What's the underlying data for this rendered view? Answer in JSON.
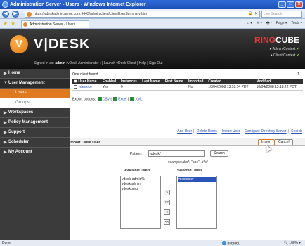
{
  "window": {
    "title": "Administration Server - Users - Windows Internet Explorer",
    "buttons": [
      "_",
      "□",
      "✕"
    ]
  },
  "addressbar": {
    "url": "https://vdeskadmin.acme.com:9443/admin/client/clientUserSummary.htm",
    "search_placeholder": "Live Search",
    "back": "◀",
    "forward": "▶"
  },
  "tabs": {
    "active_tab": "Administration Server - Users",
    "tools": [
      "⌂ ▾",
      "✉ ▾",
      "🖶 ▾",
      "Page ▾",
      "Tools ▾"
    ]
  },
  "banner": {
    "logo_mark": "V",
    "logo_text": "V|DESK",
    "signed_prefix": "Signed in as: ",
    "signed_user": "admin",
    "signed_rest": " (vDesk Administrator ) | Launch vDesk Client | Help | Sign Out",
    "rc_brand_1": "RING",
    "rc_brand_2": "CUBE",
    "rc_line1": "Admin Context",
    "rc_line2": "Client Context"
  },
  "sidebar": {
    "items": [
      {
        "label": "Home"
      },
      {
        "label": "User Management"
      },
      {
        "label": "Workspaces"
      },
      {
        "label": "Policy Management"
      },
      {
        "label": "Support"
      },
      {
        "label": "Scheduler"
      },
      {
        "label": "My Account"
      }
    ],
    "subitems": [
      {
        "label": "Users"
      },
      {
        "label": "Groups"
      }
    ]
  },
  "users": {
    "found_text": "One client found.",
    "page_number": "1",
    "columns": [
      "User Name",
      "Enabled",
      "Instances",
      "Last Name",
      "First Name",
      "Imported",
      "Created",
      "Modified"
    ],
    "rows": [
      {
        "user": "vdeskice",
        "enabled": "Yes",
        "instances": "0",
        "last": "",
        "first": "",
        "imported": "No",
        "created": "10/04/2008 13:18:14 PDT",
        "modified": "10/04/2008 13:18:22 PDT"
      }
    ],
    "export_label": "Export options:",
    "export_csv": "CSV",
    "export_excel": "Excel",
    "export_xml": "XML",
    "actions": [
      "Add User",
      "Delete Users",
      "Import User",
      "Configure Directory Server",
      "Search"
    ]
  },
  "import": {
    "title": "Import Client User",
    "import_btn": "Import",
    "cancel_btn": "Cancel",
    "pattern_label": "Pattern:",
    "pattern_value": "vdesk*",
    "search_btn": "Search",
    "example": "example:abc*, \"abc\", a*b*",
    "available_title": "Available Users",
    "selected_title": "Selected Users",
    "available_users": [
      "vdesk-admin%",
      "vdeskadmin",
      "vdeskguru"
    ],
    "selected_users": [
      "vdeskuser"
    ],
    "move_buttons": [
      ">",
      ">>",
      "<",
      "<<"
    ]
  },
  "statusbar": {
    "left": "Done",
    "zone": "Internet",
    "zoom": "100%"
  }
}
